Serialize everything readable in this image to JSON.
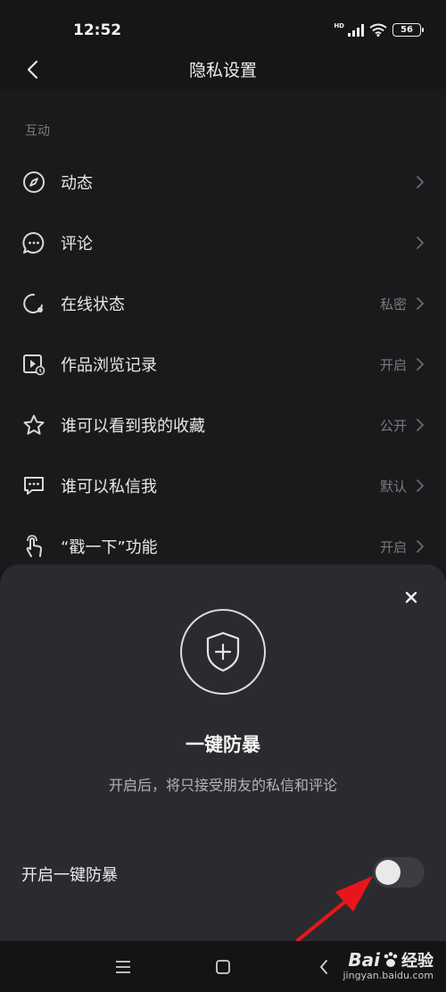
{
  "status": {
    "time": "12:52",
    "hd": "HD",
    "battery": "56"
  },
  "header": {
    "title": "隐私设置"
  },
  "section": {
    "label": "互动"
  },
  "rows": [
    {
      "label": "动态",
      "value": "",
      "icon": "compass-icon"
    },
    {
      "label": "评论",
      "value": "",
      "icon": "comment-icon"
    },
    {
      "label": "在线状态",
      "value": "私密",
      "icon": "online-status-icon"
    },
    {
      "label": "作品浏览记录",
      "value": "开启",
      "icon": "play-history-icon"
    },
    {
      "label": "谁可以看到我的收藏",
      "value": "公开",
      "icon": "star-icon"
    },
    {
      "label": "谁可以私信我",
      "value": "默认",
      "icon": "message-icon"
    },
    {
      "label": "“戳一下”功能",
      "value": "开启",
      "icon": "poke-hand-icon"
    }
  ],
  "sheet": {
    "title": "一键防暴",
    "description": "开启后，将只接受朋友的私信和评论",
    "toggle_label": "开启一键防暴",
    "toggle_on": false
  },
  "watermark": {
    "brand": "Bai",
    "brand2": "经验",
    "url": "jingyan.baidu.com"
  },
  "colors": {
    "background": "#161618",
    "sheet": "#2b2b2f",
    "arrow": "#e8161b"
  }
}
